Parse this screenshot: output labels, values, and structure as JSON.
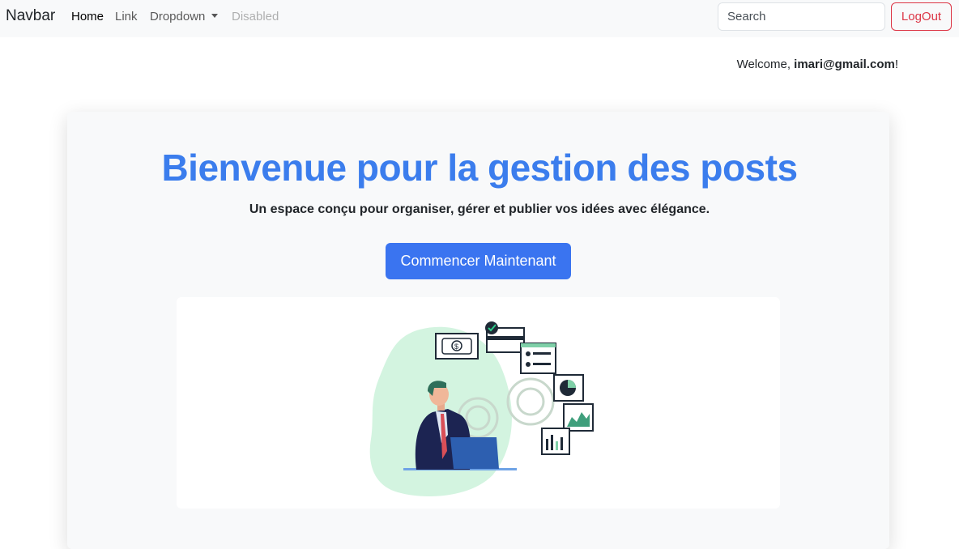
{
  "navbar": {
    "brand": "Navbar",
    "links": [
      {
        "label": "Home",
        "state": "active"
      },
      {
        "label": "Link",
        "state": "normal"
      },
      {
        "label": "Dropdown",
        "state": "dropdown"
      },
      {
        "label": "Disabled",
        "state": "disabled"
      }
    ],
    "search_placeholder": "Search",
    "logout_label": "LogOut"
  },
  "welcome": {
    "prefix": "Welcome, ",
    "email": "imari@gmail.com",
    "suffix": "!"
  },
  "hero": {
    "title": "Bienvenue pour la gestion des posts",
    "subtitle": "Un espace conçu pour organiser, gérer et publier vos idées avec élégance.",
    "cta_label": "Commencer Maintenant",
    "illustration": "businessman-dashboard-illustration"
  },
  "colors": {
    "accent": "#3a74f0",
    "title": "#3b7ded",
    "danger": "#dc3545",
    "navbar_bg": "#f8f9fa"
  }
}
